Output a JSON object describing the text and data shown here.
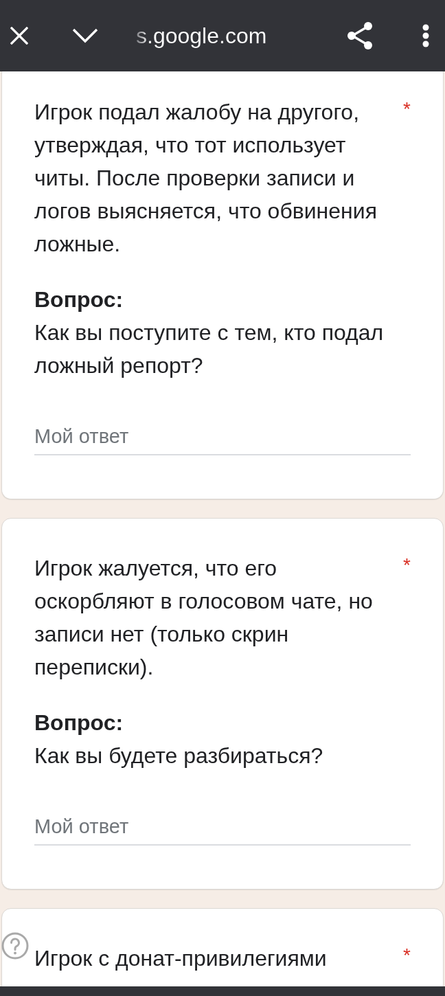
{
  "browser_bar": {
    "url": "s.google.com"
  },
  "questions": [
    {
      "description": "Игрок подал жалобу на другого, утверждая, что тот использует читы. После проверки записи и логов выясняется, что обвинения ложные.",
      "required_mark": "*",
      "question_label": "Вопрос:",
      "question": "Как вы поступите с тем, кто подал ложный репорт?",
      "answer_placeholder": "Мой ответ"
    },
    {
      "description": "Игрок жалуется, что его оскорбляют в голосовом чате, но записи нет (только скрин переписки).",
      "required_mark": "*",
      "question_label": "Вопрос:",
      "question": "Как вы будете разбираться?",
      "answer_placeholder": "Мой ответ"
    },
    {
      "description": "Игрок с донат-привилегиями",
      "required_mark": "*"
    }
  ]
}
